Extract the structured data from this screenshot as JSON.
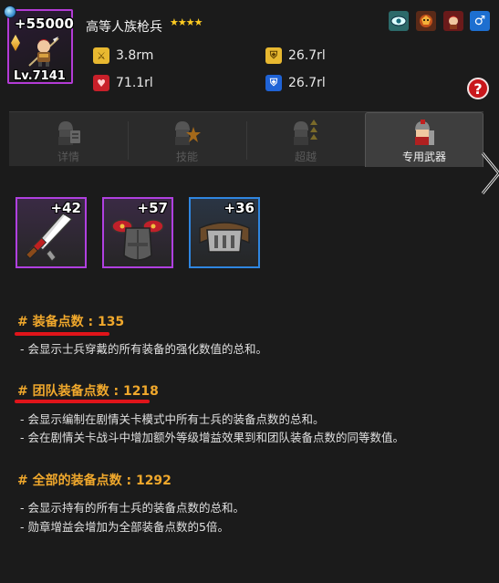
{
  "hero": {
    "power": "+55000",
    "level": "Lv.7141",
    "name": "高等人族枪兵",
    "stars": "★★★★",
    "frame_color": "#b43bd6"
  },
  "stats": {
    "attack": "3.8rm",
    "hp": "71.1rl",
    "defense": "26.7rl",
    "magic_defense": "26.7rl"
  },
  "top_icons": [
    "eye-icon",
    "dragon-icon",
    "costume-icon",
    "male-gender-icon"
  ],
  "help_label": "?",
  "tabs": [
    {
      "label": "详情",
      "icon": "soldier-scroll-icon",
      "active": false
    },
    {
      "label": "技能",
      "icon": "soldier-burst-icon",
      "active": false
    },
    {
      "label": "超越",
      "icon": "soldier-arrows-icon",
      "active": false
    },
    {
      "label": "专用武器",
      "icon": "soldier-weapon-icon",
      "active": true
    }
  ],
  "equipment": [
    {
      "bonus": "+42",
      "icon": "sword-icon",
      "rarity_color": "#b040e0"
    },
    {
      "bonus": "+57",
      "icon": "armor-icon",
      "rarity_color": "#b040e0"
    },
    {
      "bonus": "+36",
      "icon": "belt-icon",
      "rarity_color": "#2f86e0"
    }
  ],
  "sections": [
    {
      "title": "# 装备点数 : 135",
      "lines": [
        "-  会显示士兵穿戴的所有装备的强化数值的总和。"
      ]
    },
    {
      "title": "# 团队装备点数 : 1218",
      "lines": [
        "-  会显示编制在剧情关卡模式中所有士兵的装备点数的总和。",
        "-  会在剧情关卡战斗中增加额外等级增益效果到和团队装备点数的同等数值。"
      ]
    },
    {
      "title": "# 全部的装备点数 : 1292",
      "lines": [
        "-  会显示持有的所有士兵的装备点数的总和。",
        "-  勋章增益会增加为全部装备点数的5倍。"
      ]
    }
  ],
  "colors": {
    "section_title": "#f0a82c",
    "underline": "#e0141a",
    "background": "#1b1b1b"
  }
}
